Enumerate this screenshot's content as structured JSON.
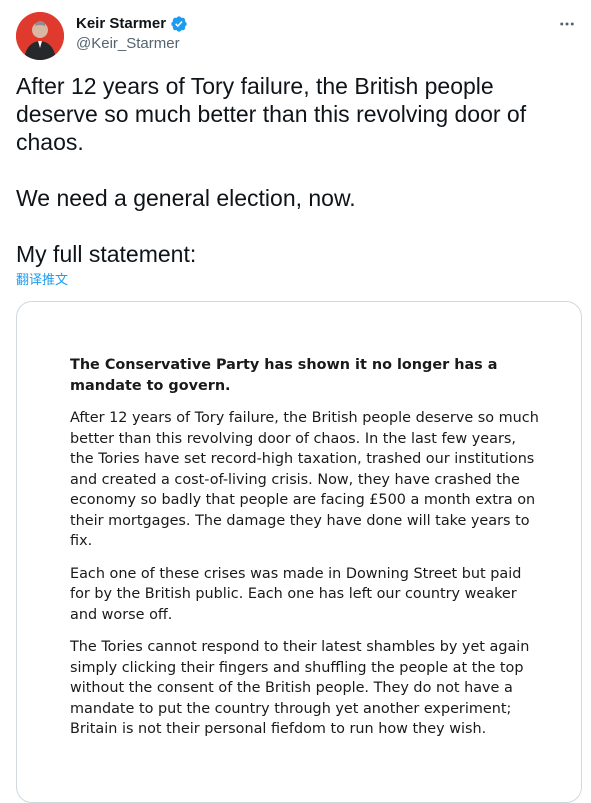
{
  "author": {
    "display_name": "Keir Starmer",
    "handle": "@Keir_Starmer",
    "verified": true,
    "avatar_icon": "profile-photo",
    "avatar_bg": "#e03a2f"
  },
  "tweet": {
    "paragraphs": [
      "After 12 years of Tory failure, the British people deserve so much better than this revolving door of chaos.",
      "We need a general election, now.",
      "My full statement:"
    ],
    "translate_label": "翻译推文"
  },
  "statement": {
    "heading": "The Conservative Party has shown it no longer has a mandate to govern.",
    "paragraphs": [
      "After 12 years of Tory failure, the British people deserve so much better than this revolving door of chaos. In the last few years, the Tories have set record-high taxation, trashed our institutions and created a cost-of-living crisis. Now, they have crashed the economy so badly that people are facing £500 a month extra on their mortgages. The damage they have done will take years to fix.",
      "Each one of these crises was made in Downing Street but paid for by the British public. Each one has left our country weaker and worse off.",
      "The Tories cannot respond to their latest shambles by yet again simply clicking their fingers and shuffling the people at the top without the consent of the British people. They do not have a mandate to put the country through yet another experiment; Britain is not their personal fiefdom to run how they wish."
    ]
  },
  "colors": {
    "text": "#0f1419",
    "secondary": "#536471",
    "link": "#1d9bf0",
    "verified": "#1d9bf0",
    "border": "#cfd9de"
  }
}
